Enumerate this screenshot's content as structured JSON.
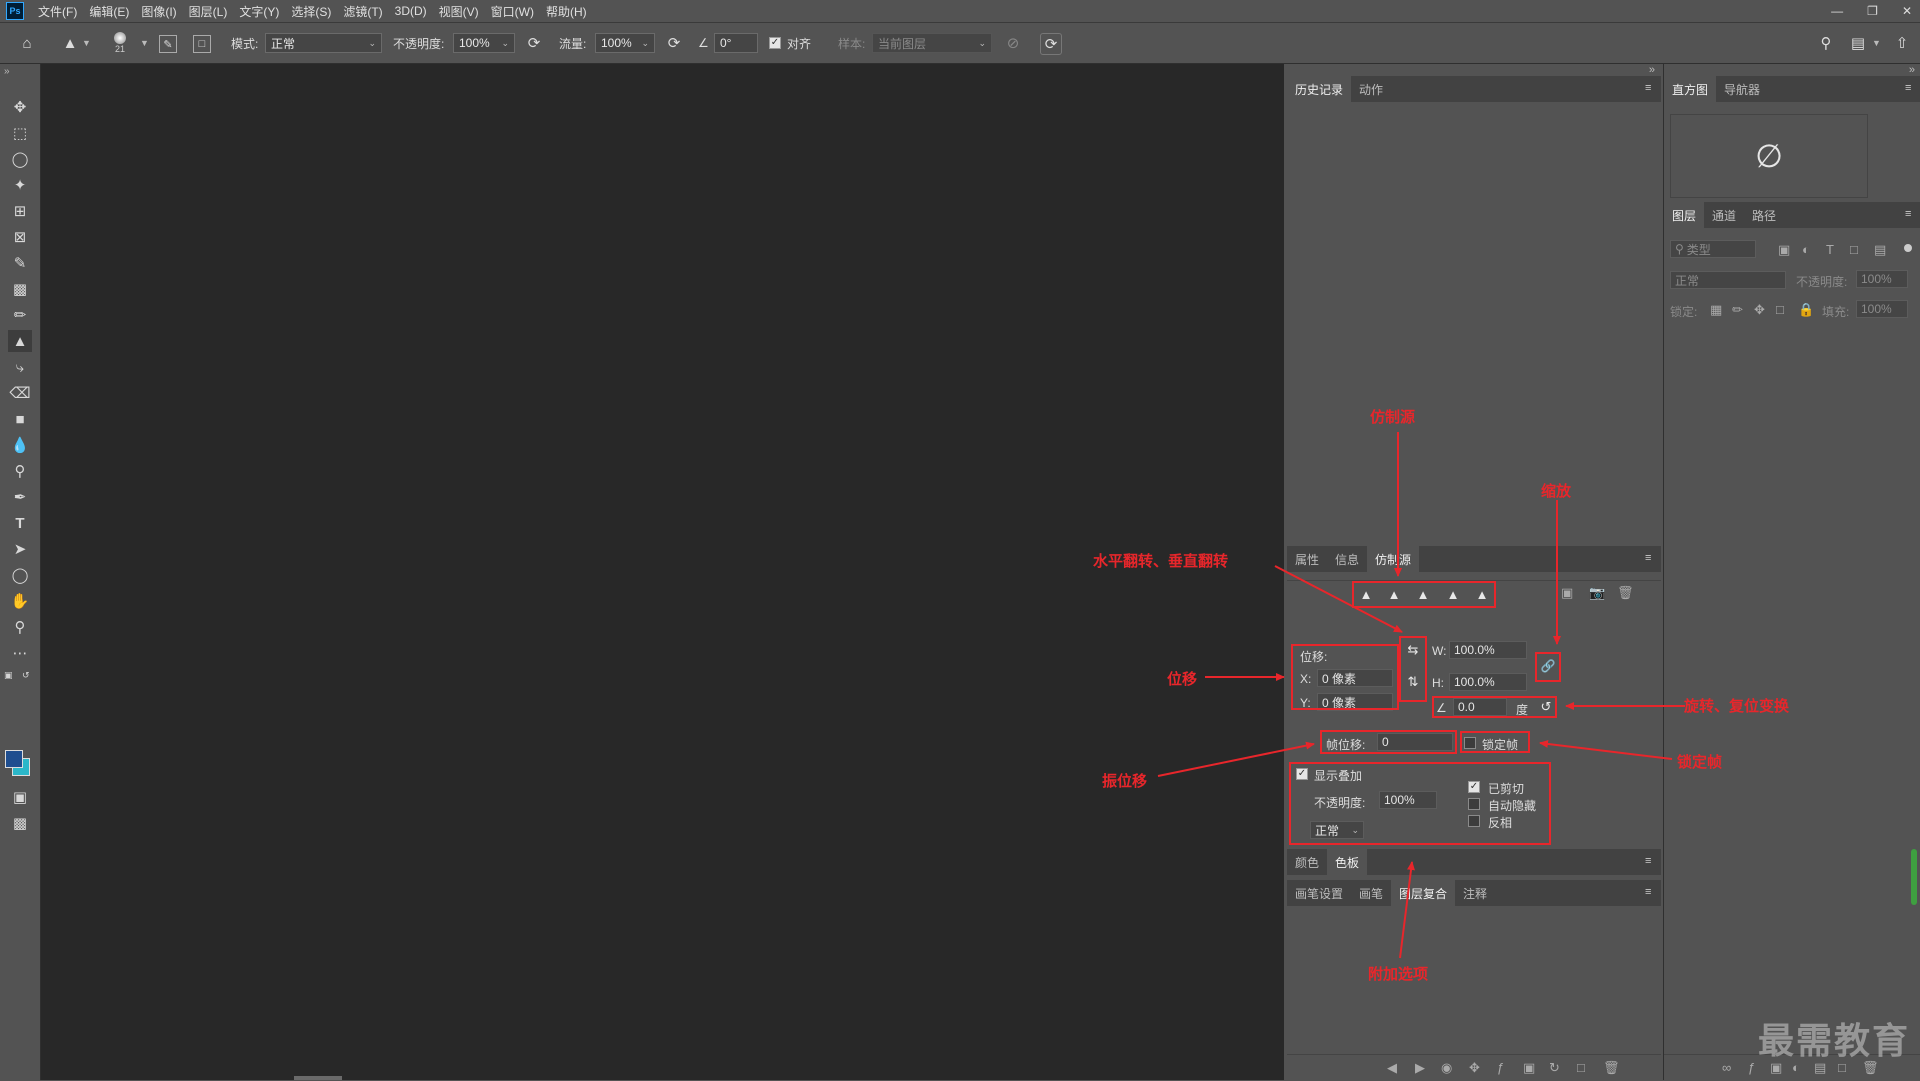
{
  "menu": {
    "logo": "Ps",
    "items": [
      "文件(F)",
      "编辑(E)",
      "图像(I)",
      "图层(L)",
      "文字(Y)",
      "选择(S)",
      "滤镜(T)",
      "3D(D)",
      "视图(V)",
      "窗口(W)",
      "帮助(H)"
    ]
  },
  "options": {
    "brush_size": "21",
    "mode_label": "模式:",
    "mode_value": "正常",
    "opacity_label": "不透明度:",
    "opacity_value": "100%",
    "flow_label": "流量:",
    "flow_value": "100%",
    "angle_value": "0°",
    "align_label": "对齐",
    "align_checked": true,
    "sample_label": "样本:",
    "sample_value": "当前图层"
  },
  "history_panel": {
    "tabs": [
      "历史记录",
      "动作"
    ],
    "active": 0
  },
  "clone_panel": {
    "tabs": [
      "属性",
      "信息",
      "仿制源"
    ],
    "offset_label": "位移:",
    "x_label": "X:",
    "x_value": "0 像素",
    "y_label": "Y:",
    "y_value": "0 像素",
    "w_label": "W:",
    "w_value": "100.0%",
    "h_label": "H:",
    "h_value": "100.0%",
    "angle_value": "0.0",
    "degree_label": "度",
    "frame_offset_label": "帧位移:",
    "frame_offset_value": "0",
    "lock_frame_label": "锁定帧",
    "show_overlay_label": "显示叠加",
    "overlay_opacity_label": "不透明度:",
    "overlay_opacity_value": "100%",
    "blend_mode_value": "正常",
    "clipped_label": "已剪切",
    "autohide_label": "自动隐藏",
    "invert_label": "反相"
  },
  "color_panel": {
    "tabs": [
      "颜色",
      "色板"
    ],
    "active": 1
  },
  "brush_panel": {
    "tabs": [
      "画笔设置",
      "画笔",
      "图层复合",
      "注释"
    ],
    "active": 2
  },
  "histogram_panel": {
    "tabs": [
      "直方图",
      "导航器"
    ],
    "active": 0
  },
  "layers_panel": {
    "tabs": [
      "图层",
      "通道",
      "路径"
    ],
    "filter_placeholder": "类型",
    "blend_mode": "正常",
    "opacity_label": "不透明度:",
    "opacity_value": "100%",
    "lock_label": "锁定:",
    "fill_label": "填充:",
    "fill_value": "100%"
  },
  "annotations": {
    "clone_source": "仿制源",
    "scale": "缩放",
    "flip": "水平翻转、垂直翻转",
    "offset": "位移",
    "rotate_reset": "旋转、复位变换",
    "frame_offset": "振位移",
    "lock_frame": "锁定帧",
    "extra_options": "附加选项"
  },
  "watermark": "最需教育",
  "colors": {
    "annotation": "#e8262b",
    "canvas": "#282828",
    "panel": "#535353",
    "foreground": "#1f4e8f",
    "background": "#2bb7c9"
  }
}
